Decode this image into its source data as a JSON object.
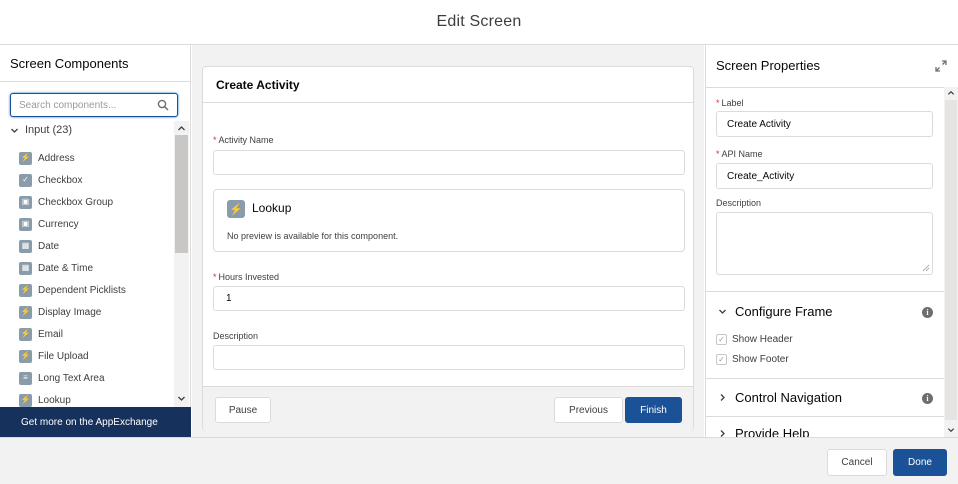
{
  "modal": {
    "title": "Edit Screen"
  },
  "left_panel": {
    "title": "Screen Components",
    "search_placeholder": "Search components...",
    "group_label": "Input (23)",
    "items": [
      {
        "label": "Address",
        "icon": "lightning-icon"
      },
      {
        "label": "Checkbox",
        "icon": "checkbox-icon"
      },
      {
        "label": "Checkbox Group",
        "icon": "checkbox-group-icon"
      },
      {
        "label": "Currency",
        "icon": "currency-icon"
      },
      {
        "label": "Date",
        "icon": "date-icon"
      },
      {
        "label": "Date & Time",
        "icon": "datetime-icon"
      },
      {
        "label": "Dependent Picklists",
        "icon": "lightning-icon"
      },
      {
        "label": "Display Image",
        "icon": "lightning-icon"
      },
      {
        "label": "Email",
        "icon": "lightning-icon"
      },
      {
        "label": "File Upload",
        "icon": "lightning-icon"
      },
      {
        "label": "Long Text Area",
        "icon": "textarea-icon"
      },
      {
        "label": "Lookup",
        "icon": "lightning-icon"
      }
    ],
    "appexchange_label": "Get more on the AppExchange"
  },
  "canvas": {
    "screen_title": "Create Activity",
    "activity_name_label": "Activity Name",
    "activity_name_value": "",
    "lookup_title": "Lookup",
    "lookup_note": "No preview is available for this component.",
    "hours_label": "Hours Invested",
    "hours_value": "1",
    "description_label": "Description",
    "description_value": "",
    "pause_label": "Pause",
    "previous_label": "Previous",
    "finish_label": "Finish"
  },
  "properties": {
    "title": "Screen Properties",
    "label_label": "Label",
    "label_value": "Create Activity",
    "api_name_label": "API Name",
    "api_name_value": "Create_Activity",
    "description_label": "Description",
    "configure_frame_label": "Configure Frame",
    "show_header_label": "Show Header",
    "show_header_checked": true,
    "show_footer_label": "Show Footer",
    "show_footer_checked": true,
    "control_navigation_label": "Control Navigation",
    "provide_help_label": "Provide Help"
  },
  "footer": {
    "cancel_label": "Cancel",
    "done_label": "Done"
  },
  "colors": {
    "brand": "#1b5297",
    "appexchange_bg": "#16325c",
    "required": "#c23934"
  }
}
